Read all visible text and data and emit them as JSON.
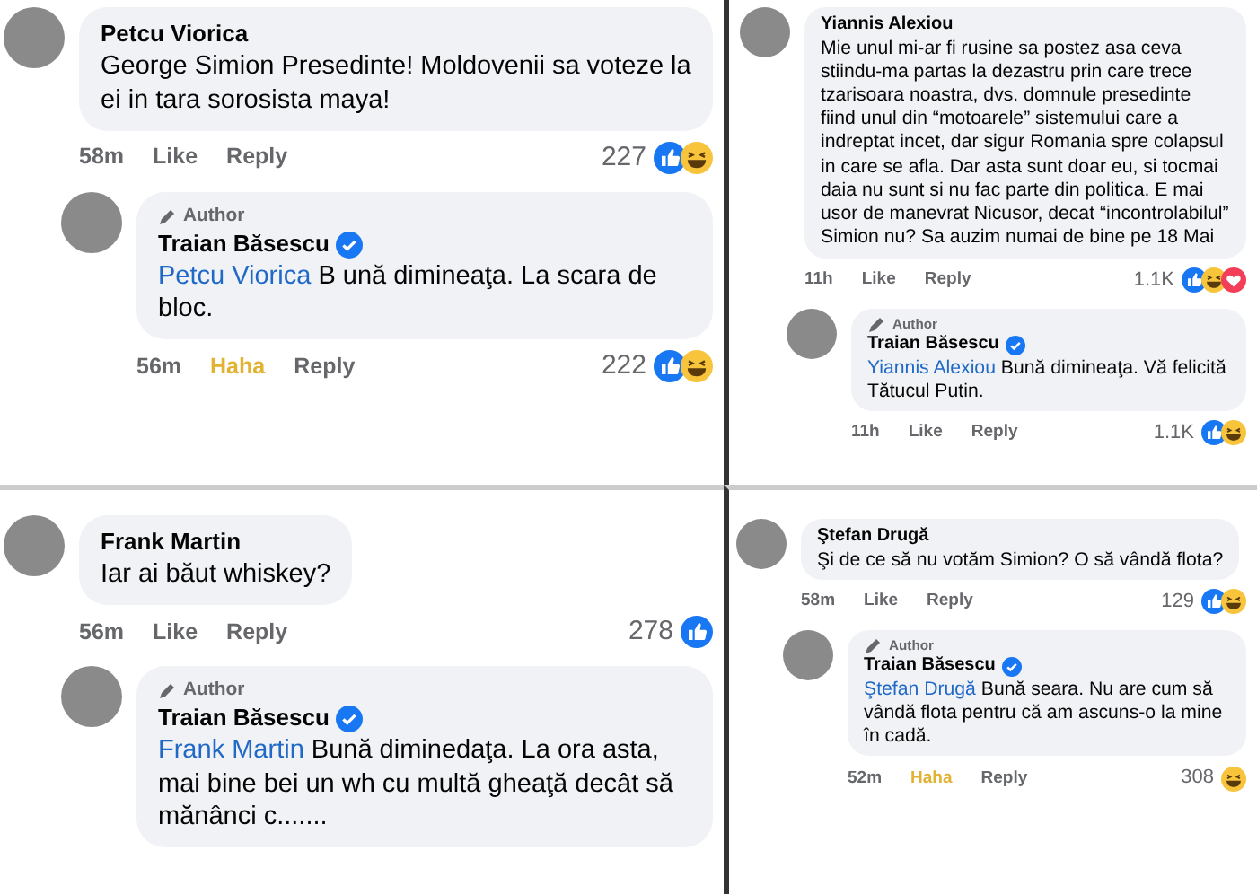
{
  "rows": [
    {
      "panels": [
        {
          "comment": {
            "author": "Petcu Viorica",
            "text": "George Simion Presedinte! Moldovenii sa voteze la ei in tara sorosista maya!",
            "time": "58m",
            "actions": [
              {
                "label": "Like",
                "active": false
              },
              {
                "label": "Reply",
                "active": false
              }
            ],
            "count": "227",
            "reactions": [
              {
                "kind": "like"
              },
              {
                "kind": "haha"
              }
            ]
          },
          "reply": {
            "badge": "Author",
            "author": "Traian Băsescu",
            "verified": true,
            "mention": "Petcu Viorica",
            "text": "B ună dimineaţa. La scara de bloc.",
            "time": "56m",
            "actions": [
              {
                "label": "Haha",
                "active": true
              },
              {
                "label": "Reply",
                "active": false
              }
            ],
            "count": "222",
            "reactions": [
              {
                "kind": "like"
              },
              {
                "kind": "haha"
              }
            ]
          }
        },
        {
          "comment": {
            "author": "Yiannis Alexiou",
            "text": "Mie unul mi-ar fi rusine sa postez asa ceva stiindu-ma partas la dezastru prin care trece tzarisoara noastra, dvs. domnule presedinte fiind unul din “motoarele” sistemului care a indreptat incet, dar sigur Romania spre colapsul in care se afla. Dar asta sunt doar eu, si tocmai daia nu sunt si nu fac parte din politica. E mai usor de manevrat Nicusor, decat “incontrolabilul” Simion nu? Sa auzim numai de bine pe 18 Mai",
            "time": "11h",
            "actions": [
              {
                "label": "Like",
                "active": false
              },
              {
                "label": "Reply",
                "active": false
              }
            ],
            "count": "1.1K",
            "reactions": [
              {
                "kind": "like"
              },
              {
                "kind": "haha"
              },
              {
                "kind": "love"
              }
            ]
          },
          "reply": {
            "badge": "Author",
            "author": "Traian Băsescu",
            "verified": true,
            "mention": "Yiannis Alexiou",
            "text": "Bună dimineaţa. Vă felicită Tătucul Putin.",
            "time": "11h",
            "actions": [
              {
                "label": "Like",
                "active": false
              },
              {
                "label": "Reply",
                "active": false
              }
            ],
            "count": "1.1K",
            "reactions": [
              {
                "kind": "like"
              },
              {
                "kind": "haha"
              }
            ]
          }
        }
      ]
    },
    {
      "panels": [
        {
          "comment": {
            "author": "Frank Martin",
            "text": "Iar ai băut whiskey?",
            "time": "56m",
            "actions": [
              {
                "label": "Like",
                "active": false
              },
              {
                "label": "Reply",
                "active": false
              }
            ],
            "count": "278",
            "reactions": [
              {
                "kind": "like"
              }
            ]
          },
          "reply": {
            "badge": "Author",
            "author": "Traian Băsescu",
            "verified": true,
            "mention": "Frank Martin",
            "text": "Bună diminedaţa. La ora asta, mai bine bei un wh cu multă gheaţă decât să mănânci c......."
          }
        },
        {
          "comment": {
            "author": "Ştefan Drugă",
            "text": "Şi de ce să nu votăm Simion? O să vândă flota?",
            "time": "58m",
            "actions": [
              {
                "label": "Like",
                "active": false
              },
              {
                "label": "Reply",
                "active": false
              }
            ],
            "count": "129",
            "reactions": [
              {
                "kind": "like"
              },
              {
                "kind": "haha"
              }
            ]
          },
          "reply": {
            "badge": "Author",
            "author": "Traian Băsescu",
            "verified": true,
            "mention": "Ştefan Drugă",
            "text": "Bună seara. Nu are cum să vândă flota pentru că am ascuns-o la mine în cadă.",
            "time": "52m",
            "actions": [
              {
                "label": "Haha",
                "active": true
              },
              {
                "label": "Reply",
                "active": false
              }
            ],
            "count": "308",
            "reactions": [
              {
                "kind": "haha"
              }
            ]
          }
        }
      ]
    }
  ]
}
